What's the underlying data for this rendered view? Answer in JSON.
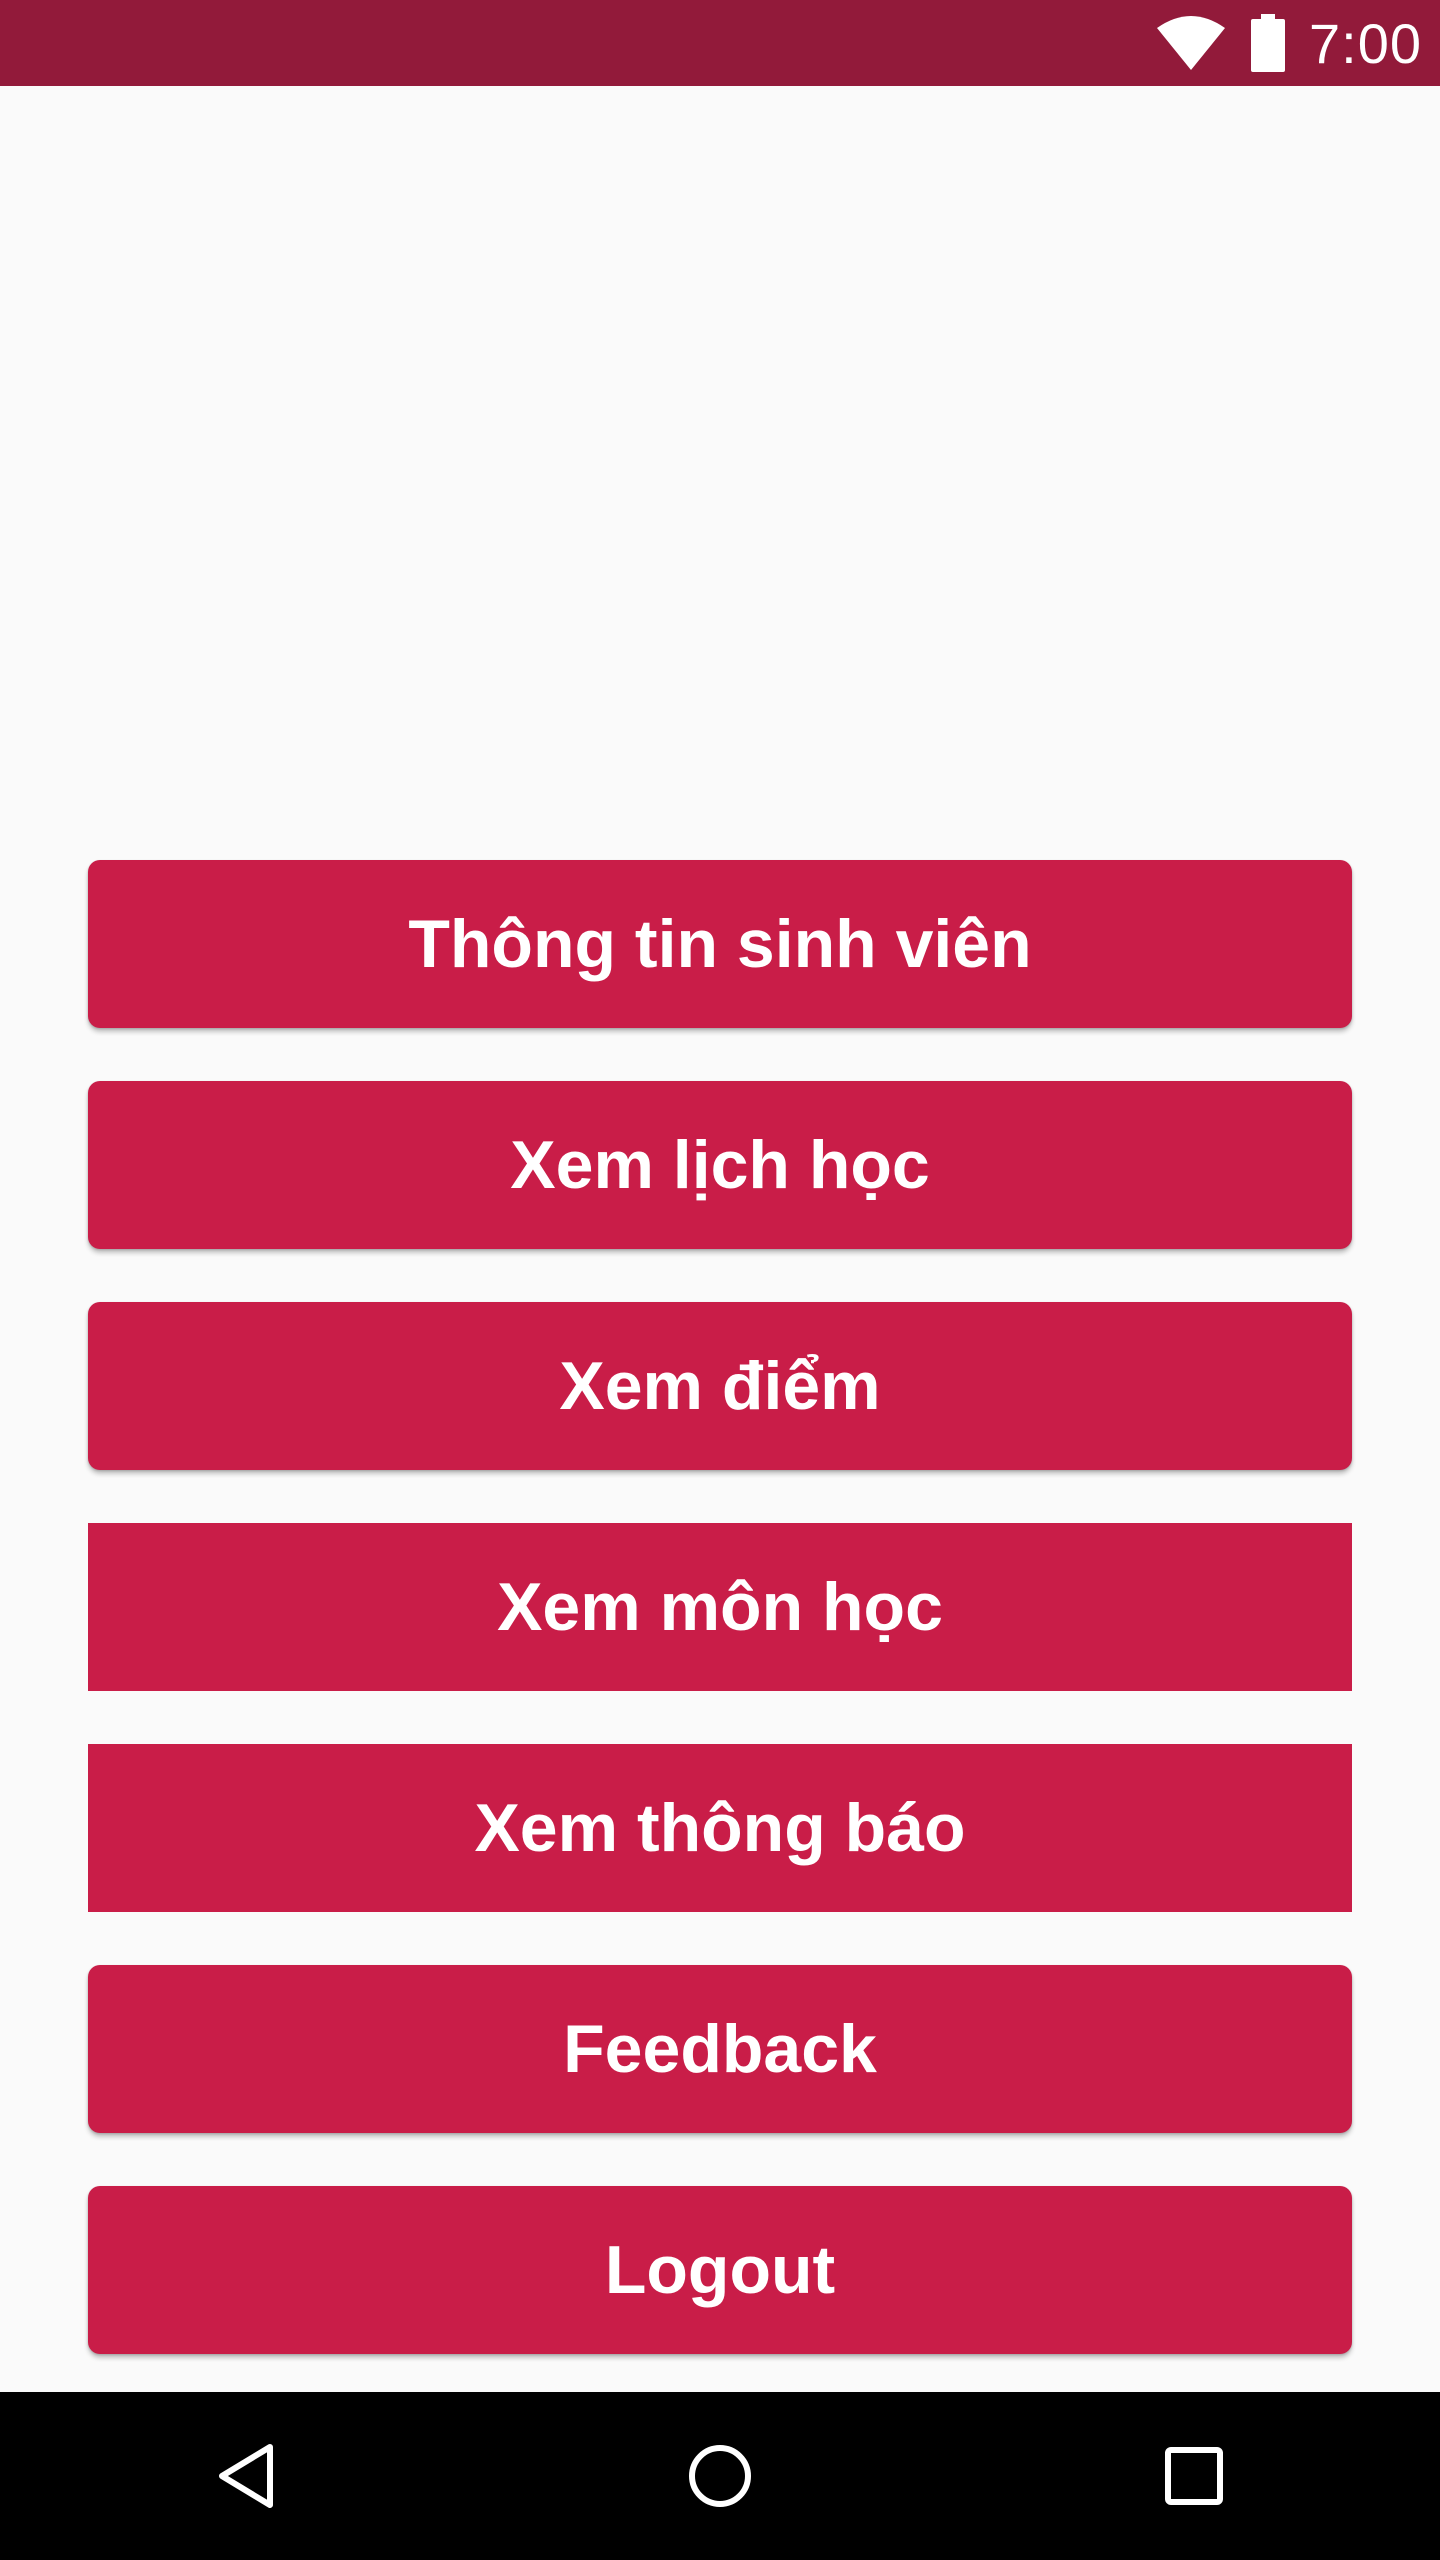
{
  "status_bar": {
    "time": "7:00",
    "icons": [
      "wifi-icon",
      "battery-icon"
    ],
    "color": "#921A3A"
  },
  "menu": {
    "accent_color": "#C91D48",
    "buttons": [
      {
        "label": "Thông tin sinh viên"
      },
      {
        "label": "Xem lịch học"
      },
      {
        "label": "Xem điểm"
      },
      {
        "label": "Xem môn học"
      },
      {
        "label": "Xem thông báo"
      },
      {
        "label": "Feedback"
      },
      {
        "label": "Logout"
      }
    ]
  },
  "nav_bar": {
    "icons": [
      "back-icon",
      "home-icon",
      "recents-icon"
    ]
  }
}
